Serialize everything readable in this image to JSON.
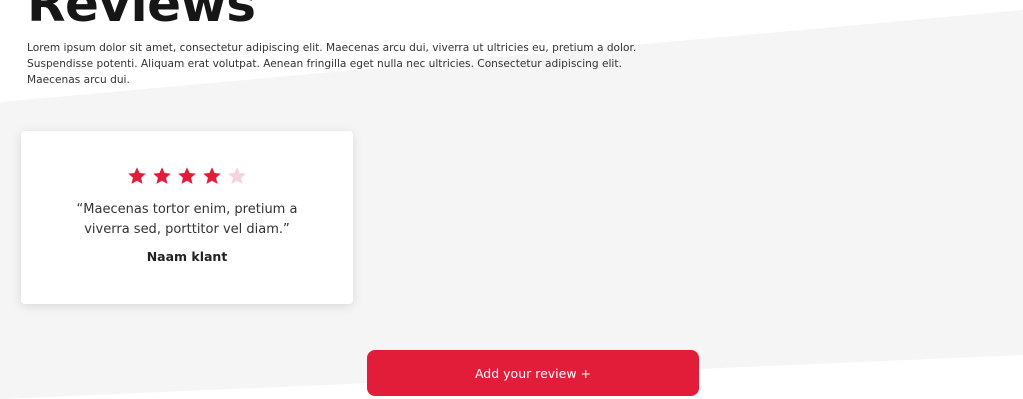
{
  "section": {
    "title": "Reviews",
    "intro": "Lorem ipsum dolor sit amet, consectetur adipiscing elit. Maecenas arcu dui, viverra ut ultricies eu, pretium a dolor. Suspendisse potenti. Aliquam erat volutpat. Aenean fringilla eget nulla nec ultricies. Consectetur adipiscing elit. Maecenas arcu dui."
  },
  "review": {
    "rating": 4,
    "max_rating": 5,
    "quote": "“Maecenas tortor enim, pretium a viverra sed, porttitor vel diam.”",
    "author": "Naam klant"
  },
  "add_review_button": {
    "label": "Add your review +"
  },
  "colors": {
    "accent": "#e11d3a",
    "star_filled": "#e11d3a",
    "star_empty": "#f6d3da",
    "band": "#f5f5f5"
  },
  "icons": {
    "star": "star-icon"
  }
}
